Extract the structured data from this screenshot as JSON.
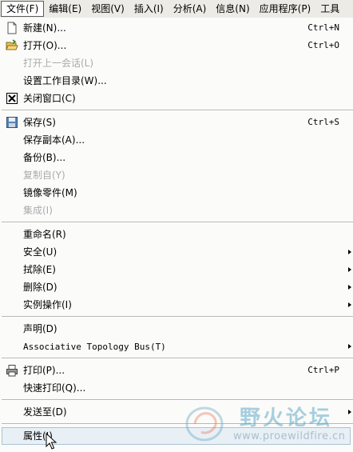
{
  "menubar": {
    "items": [
      {
        "label": "文件(F)"
      },
      {
        "label": "编辑(E)"
      },
      {
        "label": "视图(V)"
      },
      {
        "label": "插入(I)"
      },
      {
        "label": "分析(A)"
      },
      {
        "label": "信息(N)"
      },
      {
        "label": "应用程序(P)"
      },
      {
        "label": "工具"
      }
    ]
  },
  "menu": {
    "new": {
      "label": "新建(N)...",
      "shortcut": "Ctrl+N"
    },
    "open": {
      "label": "打开(O)...",
      "shortcut": "Ctrl+O"
    },
    "open_last_session": {
      "label": "打开上一会话(L)"
    },
    "set_working_dir": {
      "label": "设置工作目录(W)..."
    },
    "close_window": {
      "label": "关闭窗口(C)"
    },
    "save": {
      "label": "保存(S)",
      "shortcut": "Ctrl+S"
    },
    "save_copy": {
      "label": "保存副本(A)..."
    },
    "backup": {
      "label": "备份(B)..."
    },
    "copy_from": {
      "label": "复制自(Y)"
    },
    "mirror_part": {
      "label": "镜像零件(M)"
    },
    "integrate": {
      "label": "集成(I)"
    },
    "rename": {
      "label": "重命名(R)"
    },
    "security": {
      "label": "安全(U)"
    },
    "erase": {
      "label": "拭除(E)"
    },
    "delete": {
      "label": "删除(D)"
    },
    "instance_ops": {
      "label": "实例操作(I)"
    },
    "declare": {
      "label": "声明(D)"
    },
    "atb": {
      "label": "Associative Topology Bus(T)"
    },
    "print": {
      "label": "打印(P)...",
      "shortcut": "Ctrl+P"
    },
    "quick_print": {
      "label": "快速打印(Q)..."
    },
    "send_to": {
      "label": "发送至(D)"
    },
    "properties": {
      "label": "属性(I)"
    }
  },
  "watermark": {
    "cn": "野火论坛",
    "url": "www.proewildfire.cn"
  },
  "colors": {
    "menu_bg": "#fbfbf9",
    "disabled_text": "#a9a9a9",
    "hover_bg": "#e8f0f6",
    "hover_border": "#a9c2d6"
  }
}
